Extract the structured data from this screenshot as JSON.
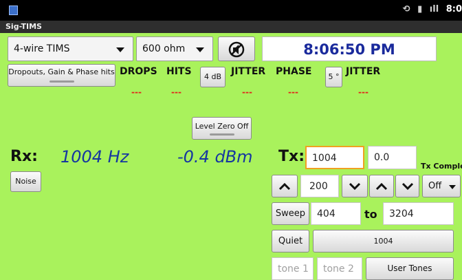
{
  "status_bar": {
    "time": "8:0"
  },
  "app_title": "Sig-TIMS",
  "mode_select": {
    "value": "4-wire TIMS"
  },
  "impedance_select": {
    "value": "600 ohm"
  },
  "clock": "8:06:50 PM",
  "dropouts_button": "Dropouts, Gain & Phase hits",
  "headers": {
    "drops": "DROPS",
    "hits": "HITS",
    "jitter1": "JITTER",
    "phase": "PHASE",
    "jitter2": "JITTER"
  },
  "db_button": "4 dB",
  "deg_button": "5 °",
  "readouts": {
    "drops": "---",
    "hits": "---",
    "jitter1": "---",
    "phase": "---",
    "jitter2": "---"
  },
  "level_zero_button": "Level Zero Off",
  "rx": {
    "label": "Rx:",
    "freq": "1004 Hz",
    "level": "-0.4 dBm"
  },
  "noise_button": "Noise",
  "tx": {
    "label": "Tx:",
    "freq_value": "1004",
    "level_value": "0.0",
    "complete_label": "Tx Comple"
  },
  "step_value": "200",
  "off_select": "Off",
  "sweep_button": "Sweep",
  "sweep_from": "404",
  "to_label": "to",
  "sweep_to": "3204",
  "quiet_button": "Quiet",
  "quiet_freq_button": "1004",
  "tone1_placeholder": "tone 1",
  "tone2_placeholder": "tone 2",
  "user_tones_button": "User Tones",
  "colors": {
    "background": "#a9f25c",
    "clock_text": "#1a2a9c",
    "readout_red": "#e2231a",
    "rx_text": "#1536a0",
    "focus_border": "#f0a020"
  }
}
